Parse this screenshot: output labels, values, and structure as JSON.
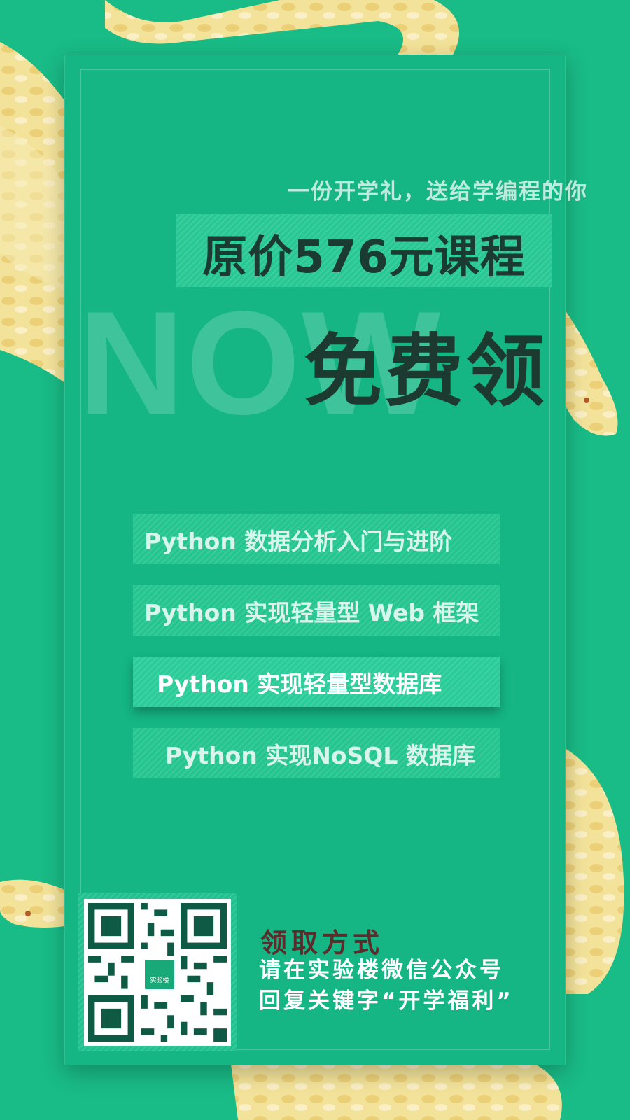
{
  "header": {
    "subtitle": "一份开学礼，送给学编程的你",
    "price_line": "原价576元课程",
    "watermark": "NOW",
    "free_label": "免费领"
  },
  "courses": [
    {
      "label": "Python 数据分析入门与进阶"
    },
    {
      "label": "Python 实现轻量型 Web 框架"
    },
    {
      "label": "Python 实现轻量型数据库"
    },
    {
      "label": "Python 实现NoSQL 数据库"
    }
  ],
  "claim": {
    "title": "领取方式",
    "line1": "请在实验楼微信公众号",
    "line2": "回复关键字“开学福利”"
  },
  "qr": {
    "logo_text": "实验楼"
  },
  "colors": {
    "background": "#19bb86",
    "card": "#15b684",
    "dark_text": "#1d3a31",
    "snake": "#f0dc8c"
  }
}
